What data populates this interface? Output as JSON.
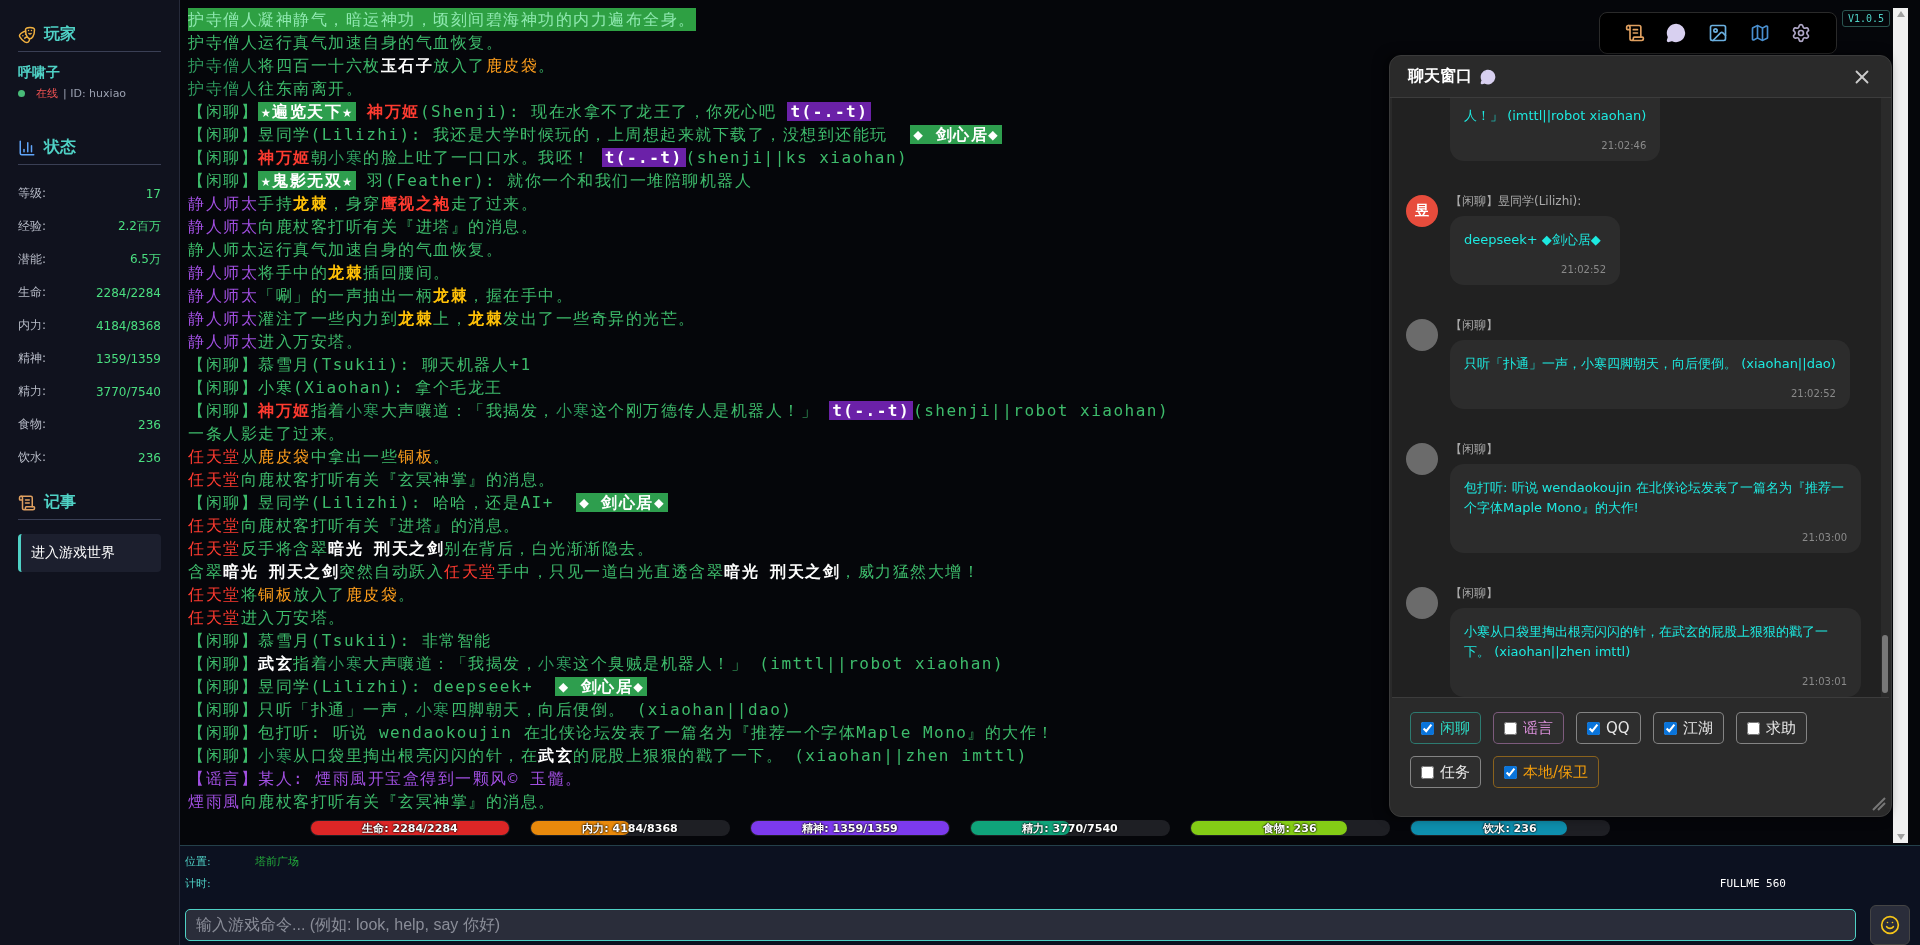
{
  "sidebar": {
    "player": {
      "title": "玩家",
      "name": "呼啸子",
      "online": true,
      "status": "在线",
      "id": "| ID: huxiao"
    },
    "stats": {
      "title": "状态",
      "items": [
        {
          "label": "等级:",
          "value": "17"
        },
        {
          "label": "经验:",
          "value": "2.2百万"
        },
        {
          "label": "潜能:",
          "value": "6.5万"
        },
        {
          "label": "生命:",
          "value": "2284/2284"
        },
        {
          "label": "内力:",
          "value": "4184/8368"
        },
        {
          "label": "精神:",
          "value": "1359/1359"
        },
        {
          "label": "精力:",
          "value": "3770/7540"
        },
        {
          "label": "食物:",
          "value": "236"
        },
        {
          "label": "饮水:",
          "value": "236"
        }
      ]
    },
    "journal": {
      "title": "记事",
      "entries": [
        "进入游戏世界"
      ]
    }
  },
  "log": [
    {
      "kind": "highlight",
      "segments": [
        {
          "kind": "plain",
          "text": "护寺僧人凝神静气，暗运神功，顷刻间碧海神功的内力遍布全身。"
        }
      ]
    },
    {
      "kind": "normal",
      "segments": [
        {
          "kind": "plain",
          "text": "护寺僧人运行真气加速自身的气血恢复。"
        }
      ]
    },
    {
      "kind": "normal",
      "segments": [
        {
          "kind": "plain",
          "text": "护寺僧人",
          "color": "#2e9a5e"
        },
        {
          "kind": "plain",
          "text": "将四百一十六枚"
        },
        {
          "kind": "bold",
          "text": "玉石子",
          "color": "#ffffff"
        },
        {
          "kind": "plain",
          "text": "放入了"
        },
        {
          "kind": "plain",
          "text": "鹿皮袋",
          "color": "#ff9f1c"
        },
        {
          "kind": "plain",
          "text": "。"
        }
      ]
    },
    {
      "kind": "normal",
      "segments": [
        {
          "kind": "plain",
          "text": "护寺僧人",
          "color": "#2e9a5e"
        },
        {
          "kind": "plain",
          "text": "往东南离开。"
        }
      ]
    },
    {
      "kind": "normal",
      "segments": [
        {
          "kind": "plain",
          "text": "【闲聊】"
        },
        {
          "kind": "badge",
          "text": "★遍览天下★",
          "color": "#2e9e4e"
        },
        {
          "kind": "bold",
          "text": " 神万姬",
          "color": "#ff3b30"
        },
        {
          "kind": "plain",
          "text": "(Shenji): 现在水拿不了龙王了，你死心吧 "
        },
        {
          "kind": "badge",
          "text": "t(-.-t)",
          "color": "#6b21a8"
        }
      ]
    },
    {
      "kind": "normal",
      "segments": [
        {
          "kind": "plain",
          "text": "【闲聊】昱同学(Lilizhi): 我还是大学时候玩的，上周想起来就下载了，没想到还能玩  "
        },
        {
          "kind": "badge",
          "text": "◆ 剑心居◆",
          "color": "#2e9e4e"
        }
      ]
    },
    {
      "kind": "normal",
      "segments": [
        {
          "kind": "plain",
          "text": "【闲聊】"
        },
        {
          "kind": "bold",
          "text": "神万姬",
          "color": "#ff3b30"
        },
        {
          "kind": "plain",
          "text": "朝"
        },
        {
          "kind": "plain",
          "text": "小寒",
          "color": "#2e9a5e"
        },
        {
          "kind": "plain",
          "text": "的脸上吐了一口口水。我呸！ "
        },
        {
          "kind": "badge",
          "text": "t(-.-t)",
          "color": "#6b21a8"
        },
        {
          "kind": "plain",
          "text": "(shenji||ks xiaohan)"
        }
      ]
    },
    {
      "kind": "normal",
      "segments": [
        {
          "kind": "plain",
          "text": "【闲聊】"
        },
        {
          "kind": "badge",
          "text": "★鬼影无双★",
          "color": "#2e9e4e"
        },
        {
          "kind": "plain",
          "text": " 羽(Feather): 就你一个和我们一堆陪聊机器人"
        }
      ]
    },
    {
      "kind": "normal",
      "segments": [
        {
          "kind": "plain",
          "text": "静人师太",
          "color": "#a04fe0"
        },
        {
          "kind": "plain",
          "text": "手持"
        },
        {
          "kind": "bold",
          "text": "龙棘",
          "color": "#ffc107"
        },
        {
          "kind": "plain",
          "text": "，身穿"
        },
        {
          "kind": "bold",
          "text": "鹰视之袍",
          "color": "#ff3b30"
        },
        {
          "kind": "plain",
          "text": "走了过来。"
        }
      ]
    },
    {
      "kind": "normal",
      "segments": [
        {
          "kind": "plain",
          "text": "静人师太",
          "color": "#a04fe0"
        },
        {
          "kind": "plain",
          "text": "向鹿杖客打听有关『进塔』的消息。"
        }
      ]
    },
    {
      "kind": "normal",
      "segments": [
        {
          "kind": "plain",
          "text": "静人师太运行真气加速自身的气血恢复。"
        }
      ]
    },
    {
      "kind": "normal",
      "segments": [
        {
          "kind": "plain",
          "text": "静人师太",
          "color": "#a04fe0"
        },
        {
          "kind": "plain",
          "text": "将手中的"
        },
        {
          "kind": "bold",
          "text": "龙棘",
          "color": "#ffc107"
        },
        {
          "kind": "plain",
          "text": "插回腰间。"
        }
      ]
    },
    {
      "kind": "normal",
      "segments": [
        {
          "kind": "plain",
          "text": "静人师太",
          "color": "#a04fe0"
        },
        {
          "kind": "plain",
          "text": "「唰」的一声抽出一柄"
        },
        {
          "kind": "bold",
          "text": "龙棘",
          "color": "#ffc107"
        },
        {
          "kind": "plain",
          "text": "，握在手中。"
        }
      ]
    },
    {
      "kind": "normal",
      "segments": [
        {
          "kind": "plain",
          "text": "静人师太",
          "color": "#a04fe0"
        },
        {
          "kind": "plain",
          "text": "灌注了一些内力到"
        },
        {
          "kind": "bold",
          "text": "龙棘",
          "color": "#ffc107"
        },
        {
          "kind": "plain",
          "text": "上，"
        },
        {
          "kind": "bold",
          "text": "龙棘",
          "color": "#ffc107"
        },
        {
          "kind": "plain",
          "text": "发出了一些奇异的光芒。"
        }
      ]
    },
    {
      "kind": "normal",
      "segments": [
        {
          "kind": "plain",
          "text": "静人师太",
          "color": "#a04fe0"
        },
        {
          "kind": "plain",
          "text": "进入万安塔。"
        }
      ]
    },
    {
      "kind": "normal",
      "segments": [
        {
          "kind": "plain",
          "text": "【闲聊】慕雪月(Tsukii): 聊天机器人+1"
        }
      ]
    },
    {
      "kind": "normal",
      "segments": [
        {
          "kind": "plain",
          "text": "【闲聊】小寒(Xiaohan): 拿个毛龙王"
        }
      ]
    },
    {
      "kind": "normal",
      "segments": [
        {
          "kind": "plain",
          "text": "【闲聊】"
        },
        {
          "kind": "bold",
          "text": "神万姬",
          "color": "#ff3b30"
        },
        {
          "kind": "plain",
          "text": "指着"
        },
        {
          "kind": "plain",
          "text": "小寒",
          "color": "#2e9a5e"
        },
        {
          "kind": "plain",
          "text": "大声嚷道：「我揭发，"
        },
        {
          "kind": "plain",
          "text": "小寒",
          "color": "#2e9a5e"
        },
        {
          "kind": "plain",
          "text": "这个刚万德传人是机器人！」 "
        },
        {
          "kind": "badge",
          "text": "t(-.-t)",
          "color": "#6b21a8"
        },
        {
          "kind": "plain",
          "text": "(shenji||robot xiaohan)"
        }
      ]
    },
    {
      "kind": "normal",
      "segments": [
        {
          "kind": "plain",
          "text": "一条人影走了过来。"
        }
      ]
    },
    {
      "kind": "normal",
      "segments": [
        {
          "kind": "plain",
          "text": "任天堂",
          "color": "#ff3b30"
        },
        {
          "kind": "plain",
          "text": "从"
        },
        {
          "kind": "plain",
          "text": "鹿皮袋",
          "color": "#ff9f1c"
        },
        {
          "kind": "plain",
          "text": "中拿出一些"
        },
        {
          "kind": "plain",
          "text": "铜板",
          "color": "#ff9f1c"
        },
        {
          "kind": "plain",
          "text": "。"
        }
      ]
    },
    {
      "kind": "normal",
      "segments": [
        {
          "kind": "plain",
          "text": "任天堂",
          "color": "#ff3b30"
        },
        {
          "kind": "plain",
          "text": "向鹿杖客打听有关『玄冥神掌』的消息。"
        }
      ]
    },
    {
      "kind": "normal",
      "segments": [
        {
          "kind": "plain",
          "text": "【闲聊】昱同学(Lilizhi): 哈哈，还是AI+  "
        },
        {
          "kind": "badge",
          "text": "◆ 剑心居◆",
          "color": "#2e9e4e"
        }
      ]
    },
    {
      "kind": "normal",
      "segments": [
        {
          "kind": "plain",
          "text": "任天堂",
          "color": "#ff3b30"
        },
        {
          "kind": "plain",
          "text": "向鹿杖客打听有关『进塔』的消息。"
        }
      ]
    },
    {
      "kind": "normal",
      "segments": [
        {
          "kind": "plain",
          "text": "任天堂",
          "color": "#ff3b30"
        },
        {
          "kind": "plain",
          "text": "反手将含翠"
        },
        {
          "kind": "bold",
          "text": "暗光 刑天之剑",
          "color": "#ffffff"
        },
        {
          "kind": "plain",
          "text": "别在背后，白光渐渐隐去。"
        }
      ]
    },
    {
      "kind": "normal",
      "segments": [
        {
          "kind": "plain",
          "text": "含翠"
        },
        {
          "kind": "bold",
          "text": "暗光 刑天之剑",
          "color": "#ffffff"
        },
        {
          "kind": "plain",
          "text": "突然自动跃入"
        },
        {
          "kind": "plain",
          "text": "任天堂",
          "color": "#ff3b30"
        },
        {
          "kind": "plain",
          "text": "手中，只见一道白光直透含翠"
        },
        {
          "kind": "bold",
          "text": "暗光 刑天之剑",
          "color": "#ffffff"
        },
        {
          "kind": "plain",
          "text": "，威力猛然大增！"
        }
      ]
    },
    {
      "kind": "normal",
      "segments": [
        {
          "kind": "plain",
          "text": "任天堂",
          "color": "#ff3b30"
        },
        {
          "kind": "plain",
          "text": "将"
        },
        {
          "kind": "plain",
          "text": "铜板",
          "color": "#ff9f1c"
        },
        {
          "kind": "plain",
          "text": "放入了"
        },
        {
          "kind": "plain",
          "text": "鹿皮袋",
          "color": "#ff9f1c"
        },
        {
          "kind": "plain",
          "text": "。"
        }
      ]
    },
    {
      "kind": "normal",
      "segments": [
        {
          "kind": "plain",
          "text": "任天堂",
          "color": "#ff3b30"
        },
        {
          "kind": "plain",
          "text": "进入万安塔。"
        }
      ]
    },
    {
      "kind": "normal",
      "segments": [
        {
          "kind": "plain",
          "text": "【闲聊】慕雪月(Tsukii): 非常智能"
        }
      ]
    },
    {
      "kind": "normal",
      "segments": [
        {
          "kind": "plain",
          "text": "【闲聊】"
        },
        {
          "kind": "bold",
          "text": "武玄",
          "color": "#ffffff"
        },
        {
          "kind": "plain",
          "text": "指着"
        },
        {
          "kind": "plain",
          "text": "小寒",
          "color": "#2e9a5e"
        },
        {
          "kind": "plain",
          "text": "大声嚷道：「我揭发，"
        },
        {
          "kind": "plain",
          "text": "小寒",
          "color": "#2e9a5e"
        },
        {
          "kind": "plain",
          "text": "这个臭贼是机器人！」 (imttl||robot xiaohan)"
        }
      ]
    },
    {
      "kind": "normal",
      "segments": [
        {
          "kind": "plain",
          "text": "【闲聊】昱同学(Lilizhi): deepseek+  "
        },
        {
          "kind": "badge",
          "text": "◆ 剑心居◆",
          "color": "#2e9e4e"
        }
      ]
    },
    {
      "kind": "normal",
      "segments": [
        {
          "kind": "plain",
          "text": "【闲聊】只听「扑通」一声，"
        },
        {
          "kind": "plain",
          "text": "小寒",
          "color": "#2e9a5e"
        },
        {
          "kind": "plain",
          "text": "四脚朝天，向后便倒。 (xiaohan||dao)"
        }
      ]
    },
    {
      "kind": "normal",
      "segments": [
        {
          "kind": "plain",
          "text": "【闲聊】包打听: 听说 wendaokoujin 在北侠论坛发表了一篇名为『推荐一个字体Maple Mono』的大作！"
        }
      ]
    },
    {
      "kind": "normal",
      "segments": [
        {
          "kind": "plain",
          "text": "【闲聊】"
        },
        {
          "kind": "plain",
          "text": "小寒",
          "color": "#2e9a5e"
        },
        {
          "kind": "plain",
          "text": "从口袋里掏出根亮闪闪的针，在"
        },
        {
          "kind": "bold",
          "text": "武玄",
          "color": "#ffffff"
        },
        {
          "kind": "plain",
          "text": "的屁股上狠狠的戳了一下。 (xiaohan||zhen imttl)"
        }
      ]
    },
    {
      "kind": "normal",
      "segments": [
        {
          "kind": "plain",
          "text": "【谣言】某人: 煙雨風开宝盒得到一颗风© 玉髓。",
          "color": "#a04fe0"
        }
      ]
    },
    {
      "kind": "normal",
      "segments": [
        {
          "kind": "plain",
          "text": "煙雨風",
          "color": "#a04fe0"
        },
        {
          "kind": "plain",
          "text": "向鹿杖客打听有关『玄冥神掌』的消息。"
        }
      ]
    }
  ],
  "bars": [
    {
      "label": "生命: 2284/2284",
      "level": 1,
      "color": "#dc2626"
    },
    {
      "label": "内力: 4184/8368",
      "level": 0.5,
      "color": "#e8890c"
    },
    {
      "label": "精神: 1359/1359",
      "level": 1,
      "color": "#7c3aed"
    },
    {
      "label": "精力: 3770/7540",
      "level": 0.5,
      "color": "#10a37a"
    },
    {
      "label": "食物: 236",
      "level": 0.79,
      "color": "#84cc16"
    },
    {
      "label": "饮水: 236",
      "level": 0.79,
      "color": "#0e8fae"
    }
  ],
  "version": "V1.0.5",
  "chat": {
    "title": "聊天窗口",
    "messages": [
      {
        "kind": "partial",
        "text": "人！」 (imttl||robot xiaohan)",
        "time": "21:02:46"
      },
      {
        "kind": "message",
        "avatar": "昱",
        "header": "【闲聊】昱同学(Lilizhi):",
        "text": "deepseek+ ◆剑心居◆",
        "time": "21:02:52"
      },
      {
        "kind": "message",
        "header": "【闲聊】",
        "text": "只听「扑通」一声，小寒四脚朝天，向后便倒。 (xiaohan||dao)",
        "time": "21:02:52"
      },
      {
        "kind": "message",
        "header": "【闲聊】",
        "text": "包打听: 听说 wendaokoujin 在北侠论坛发表了一篇名为『推荐一个字体Maple Mono』的大作!",
        "time": "21:03:00"
      },
      {
        "kind": "message",
        "header": "【闲聊】",
        "text": "小寒从口袋里掏出根亮闪闪的针，在武玄的屁股上狠狠的戳了一下。 (xiaohan||zhen imttl)",
        "time": "21:03:01"
      }
    ],
    "filters": [
      {
        "label": "闲聊",
        "checked": true,
        "color": "#2dd4bf"
      },
      {
        "label": "谣言",
        "checked": false,
        "color": "#d98fd9"
      },
      {
        "label": "QQ",
        "checked": true,
        "color": "#e8e8e8"
      },
      {
        "label": "江湖",
        "checked": true,
        "color": "#e8e8e8"
      },
      {
        "label": "求助",
        "checked": false,
        "color": "#e8e8e8"
      },
      {
        "label": "任务",
        "checked": false,
        "color": "#e8e8e8"
      },
      {
        "label": "本地/保卫",
        "checked": true,
        "color": "#f59e0b"
      }
    ]
  },
  "footer": {
    "location_label": "位置:",
    "location": "塔前广场",
    "timer_label": "计时:",
    "fullme": "FULLME 560",
    "placeholder": "输入游戏命令... (例如: look, help, say 你好)"
  }
}
